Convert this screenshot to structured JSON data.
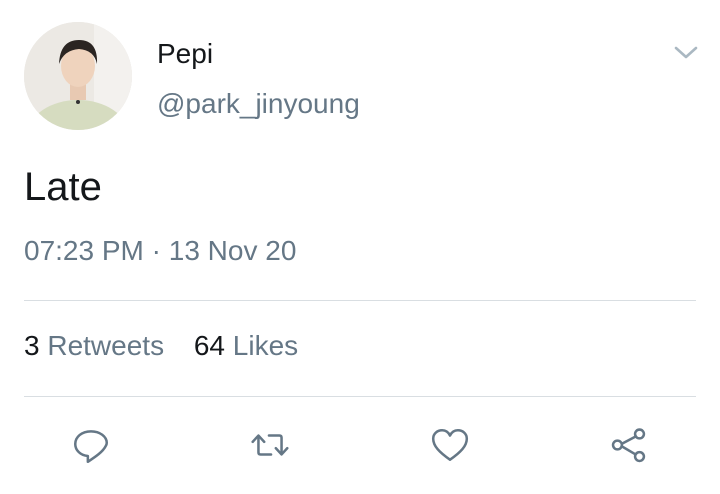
{
  "author": {
    "display_name": "Pepi",
    "handle": "@park_jinyoung"
  },
  "tweet": {
    "text": "Late",
    "time": "07:23 PM",
    "separator": "·",
    "date": "13 Nov 20"
  },
  "stats": {
    "retweets_count": "3",
    "retweets_label": "Retweets",
    "likes_count": "64",
    "likes_label": "Likes"
  },
  "actions": [
    "reply-icon",
    "retweet-icon",
    "like-icon",
    "share-icon"
  ],
  "colors": {
    "primary_text": "#14171a",
    "secondary_text": "#657786",
    "divider": "#d9dee2",
    "icon": "#657786"
  }
}
